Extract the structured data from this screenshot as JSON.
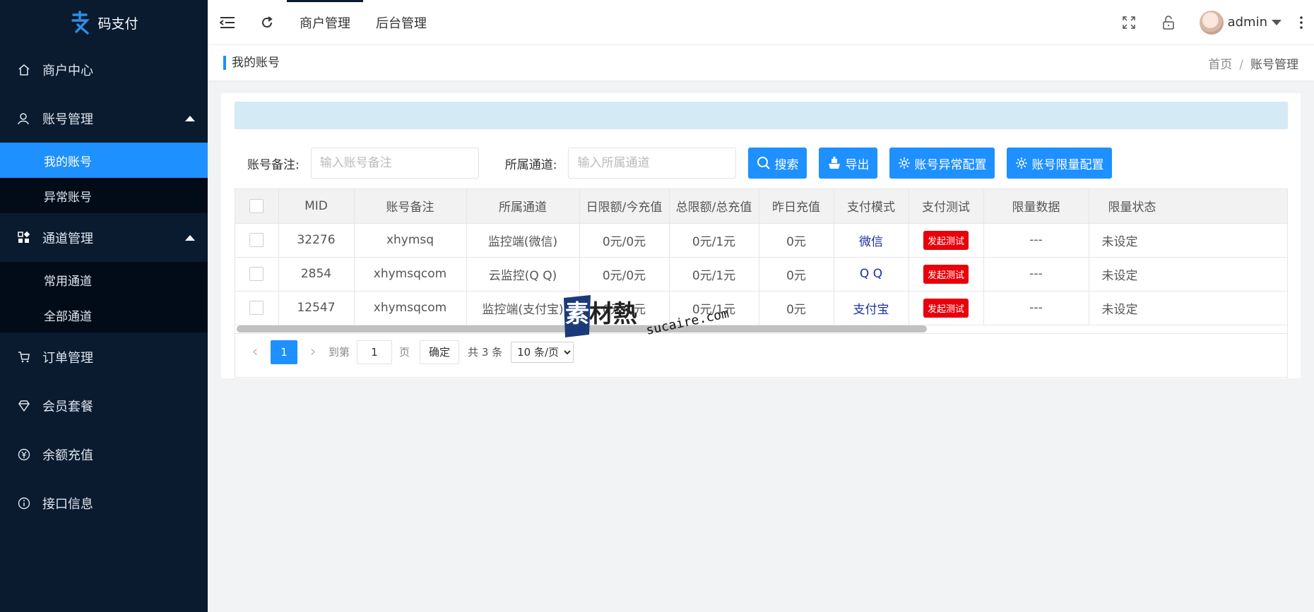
{
  "app": {
    "name": "码支付"
  },
  "sidebar": {
    "items": [
      {
        "label": "商户中心",
        "icon": "home-icon"
      },
      {
        "label": "账号管理",
        "icon": "user-icon",
        "expanded": true,
        "children": [
          {
            "label": "我的账号",
            "active": true
          },
          {
            "label": "异常账号"
          }
        ]
      },
      {
        "label": "通道管理",
        "icon": "grid-icon",
        "expanded": true,
        "children": [
          {
            "label": "常用通道"
          },
          {
            "label": "全部通道"
          }
        ]
      },
      {
        "label": "订单管理",
        "icon": "cart-icon"
      },
      {
        "label": "会员套餐",
        "icon": "diamond-icon"
      },
      {
        "label": "余额充值",
        "icon": "yen-icon"
      },
      {
        "label": "接口信息",
        "icon": "info-icon"
      }
    ]
  },
  "header": {
    "tabs": [
      {
        "label": "商户管理",
        "active": true
      },
      {
        "label": "后台管理"
      }
    ],
    "user": "admin"
  },
  "breadcrumb": {
    "title": "我的账号",
    "home": "首页",
    "sep": "/",
    "current": "账号管理"
  },
  "filter": {
    "remark_label": "账号备注:",
    "remark_placeholder": "输入账号备注",
    "channel_label": "所属通道:",
    "channel_placeholder": "输入所属通道",
    "buttons": {
      "search": "搜索",
      "export": "导出",
      "abnormal": "账号异常配置",
      "limit": "账号限量配置"
    }
  },
  "table": {
    "columns": [
      "MID",
      "账号备注",
      "所属通道",
      "日限额/今充值",
      "总限额/总充值",
      "昨日充值",
      "支付模式",
      "支付测试",
      "限量数据",
      "限量状态"
    ],
    "test_label": "发起测试",
    "rows": [
      {
        "mid": "32276",
        "remark": "xhymsq",
        "channel": "监控端(微信)",
        "daily": "0元/0元",
        "total": "0元/1元",
        "yesterday": "0元",
        "mode": "微信",
        "limit_data": "---",
        "limit_state": "未设定"
      },
      {
        "mid": "2854",
        "remark": "xhymsqcom",
        "channel": "云监控(Q Q)",
        "daily": "0元/0元",
        "total": "0元/1元",
        "yesterday": "0元",
        "mode": "Q Q",
        "limit_data": "---",
        "limit_state": "未设定"
      },
      {
        "mid": "12547",
        "remark": "xhymsqcom",
        "channel": "监控端(支付宝)",
        "daily": "0元/0元",
        "total": "0元/1元",
        "yesterday": "0元",
        "mode": "支付宝",
        "limit_data": "---",
        "limit_state": "未设定"
      }
    ]
  },
  "pager": {
    "current": "1",
    "goto_label": "到第",
    "page_value": "1",
    "page_unit": "页",
    "confirm": "确定",
    "total": "共 3 条",
    "page_size": "10 条/页"
  },
  "watermark": {
    "text": "素材熱",
    "url": "sucaire.com"
  },
  "colors": {
    "sidebar_bg": "#0a1a2f",
    "accent": "#1e90ff",
    "danger": "#e8000b"
  }
}
